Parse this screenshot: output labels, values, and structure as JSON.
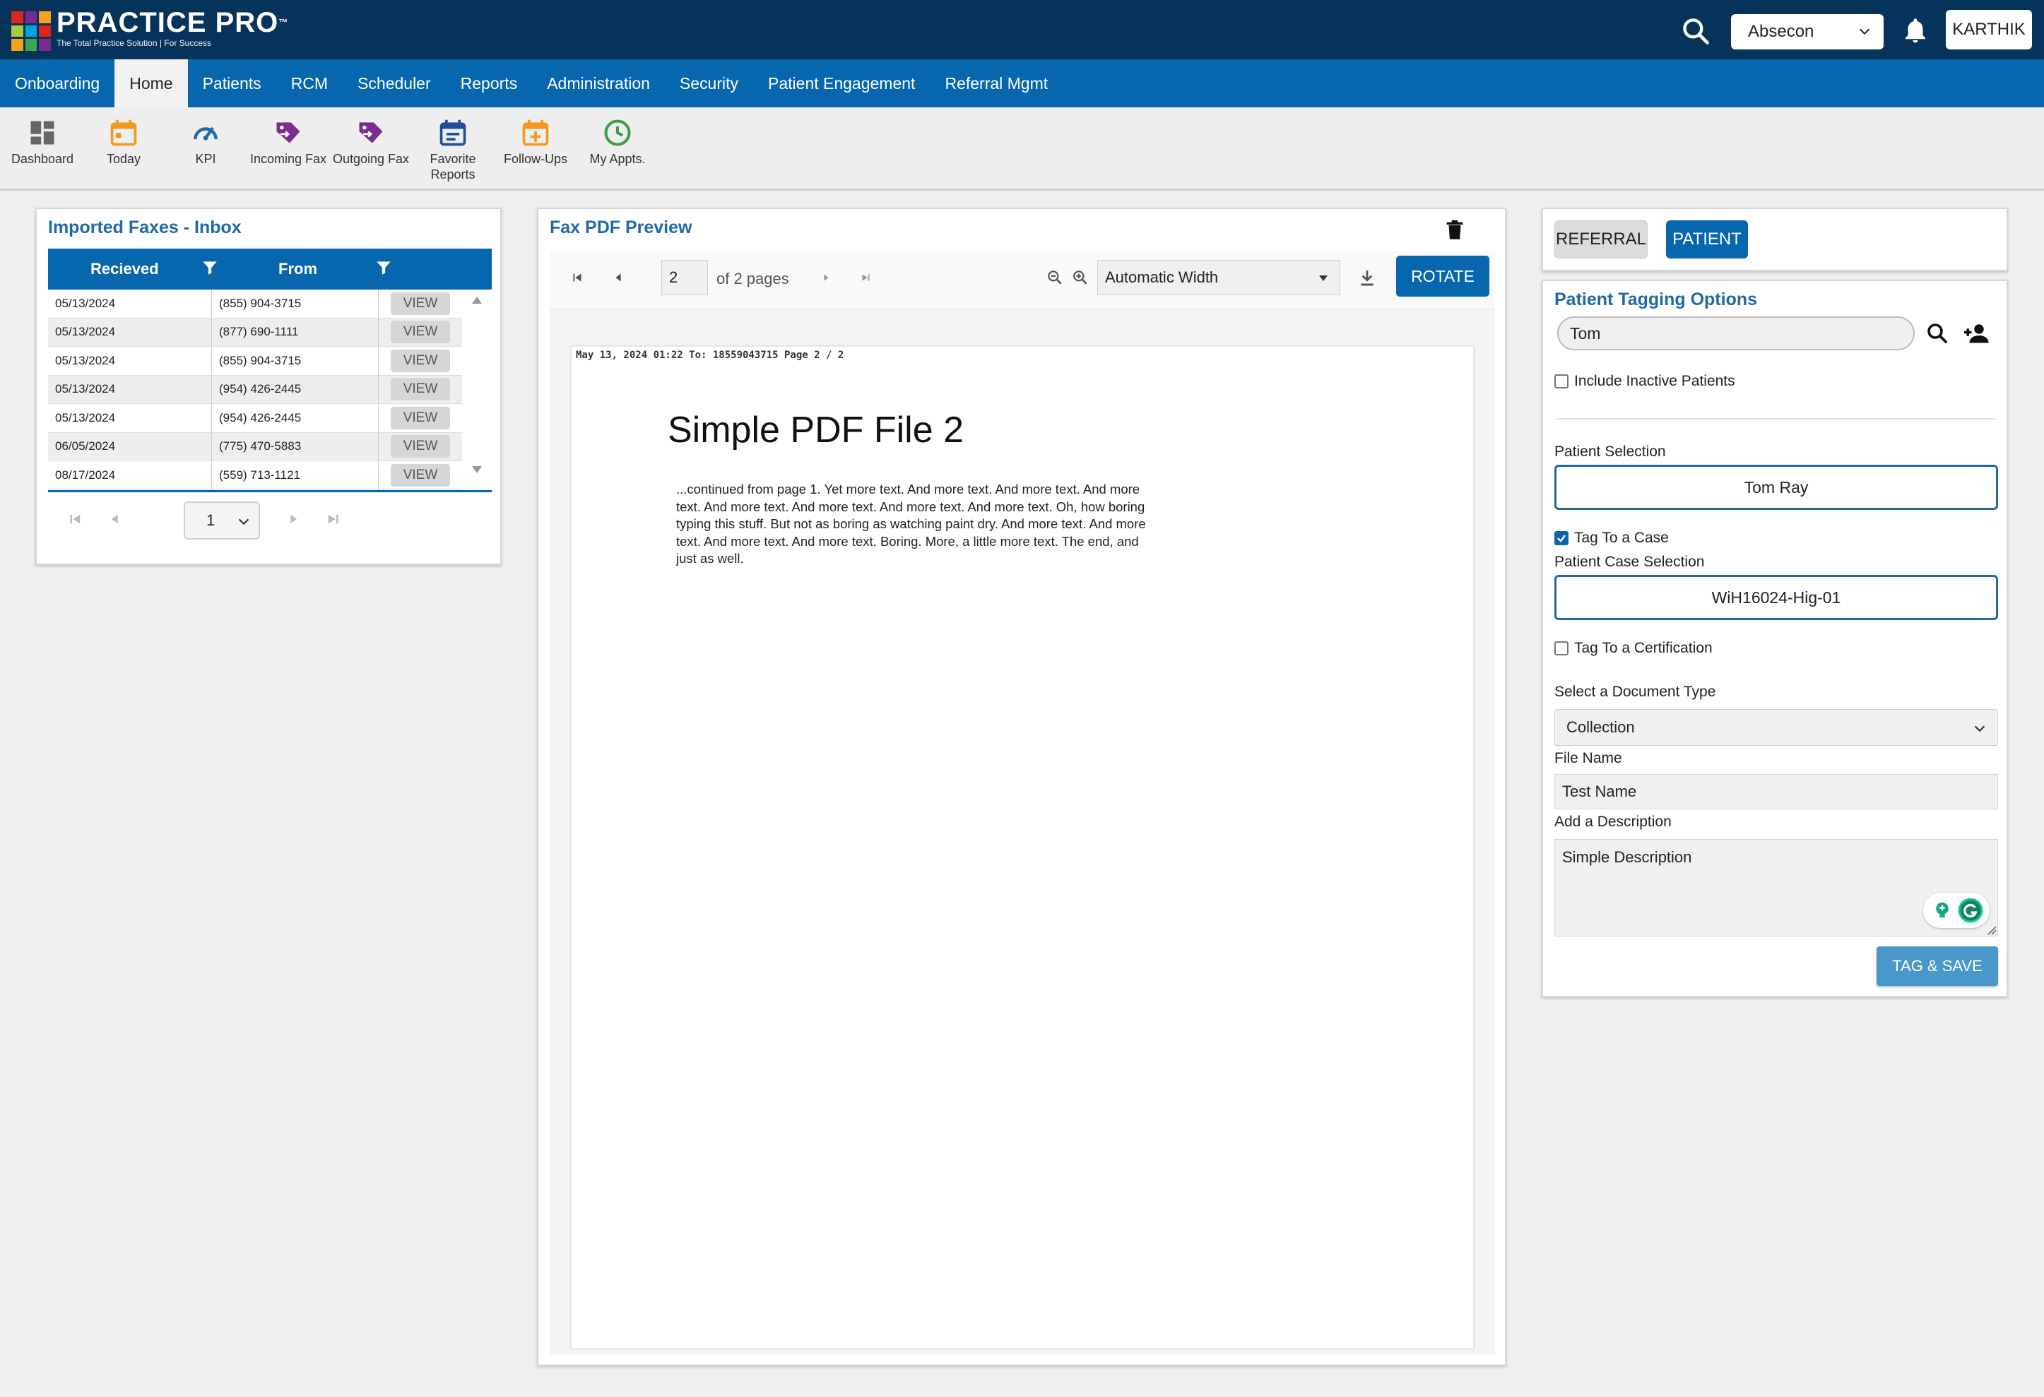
{
  "app": {
    "logo_title": "PRACTICE PRO",
    "logo_tm": "™",
    "logo_tagline": "The Total Practice Solution | For Success",
    "location": "Absecon",
    "user": "KARTHIK"
  },
  "nav": {
    "items": [
      "Onboarding",
      "Home",
      "Patients",
      "RCM",
      "Scheduler",
      "Reports",
      "Administration",
      "Security",
      "Patient Engagement",
      "Referral Mgmt"
    ],
    "active": "Home"
  },
  "quick": {
    "items": [
      {
        "label": "Dashboard",
        "icon": "dashboard-icon"
      },
      {
        "label": "Today",
        "icon": "calendar-today-icon"
      },
      {
        "label": "KPI",
        "icon": "gauge-icon"
      },
      {
        "label": "Incoming Fax",
        "icon": "incoming-fax-icon"
      },
      {
        "label": "Outgoing Fax",
        "icon": "outgoing-fax-icon"
      },
      {
        "label": "Favorite Reports",
        "icon": "report-icon"
      },
      {
        "label": "Follow-Ups",
        "icon": "calendar-add-icon"
      },
      {
        "label": "My Appts.",
        "icon": "clock-icon"
      }
    ]
  },
  "faxes": {
    "title": "Imported Faxes - Inbox",
    "col_received": "Recieved",
    "col_from": "From",
    "view_label": "VIEW",
    "rows": [
      {
        "date": "05/13/2024",
        "from": "(855) 904-3715"
      },
      {
        "date": "05/13/2024",
        "from": "(877) 690-1111"
      },
      {
        "date": "05/13/2024",
        "from": "(855) 904-3715"
      },
      {
        "date": "05/13/2024",
        "from": "(954) 426-2445"
      },
      {
        "date": "05/13/2024",
        "from": "(954) 426-2445"
      },
      {
        "date": "06/05/2024",
        "from": "(775) 470-5883"
      },
      {
        "date": "08/17/2024",
        "from": "(559) 713-1121"
      }
    ],
    "page": "1"
  },
  "pdf": {
    "title": "Fax PDF Preview",
    "page_value": "2",
    "of_pages": "of 2 pages",
    "zoom_mode": "Automatic Width",
    "rotate_label": "ROTATE",
    "fax_header": "May 13, 2024 01:22 To: 18559043715 Page 2 / 2",
    "doc_title": "Simple PDF File 2",
    "doc_body": "...continued from page 1. Yet more text. And more text. And more text. And more text. And more text. And more text. And more text. And more text. Oh, how boring typing this stuff. But not as boring as watching paint dry. And more text. And more text. And more text. And more text. Boring.  More, a little more text. The end, and just as well."
  },
  "tabs": {
    "referral": "REFERRAL",
    "patient": "PATIENT"
  },
  "tagging": {
    "title": "Patient Tagging Options",
    "search_value": "Tom",
    "include_inactive": "Include Inactive Patients",
    "patient_selection_label": "Patient Selection",
    "patient_selection_value": "Tom Ray",
    "tag_case_label": "Tag To a Case",
    "case_selection_label": "Patient Case Selection",
    "case_selection_value": "WiH16024-Hig-01",
    "tag_cert_label": "Tag To a Certification",
    "doc_type_label": "Select a Document Type",
    "doc_type_value": "Collection",
    "file_name_label": "File Name",
    "file_name_value": "Test Name",
    "description_label": "Add a Description",
    "description_value": "Simple Description",
    "save_label": "TAG & SAVE"
  }
}
